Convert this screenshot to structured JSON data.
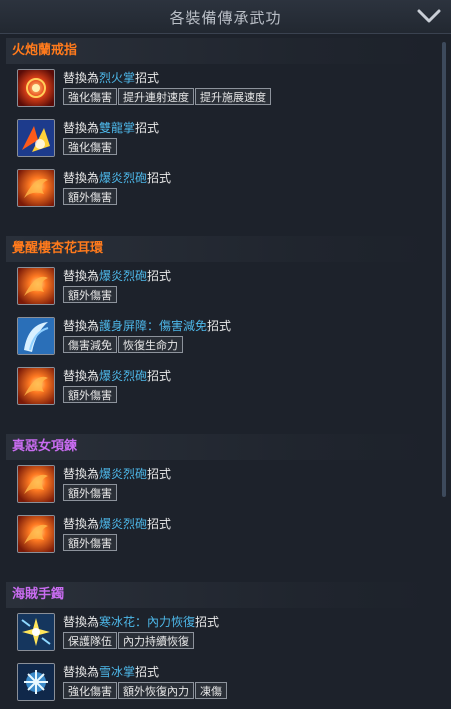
{
  "header": {
    "title": "各裝備傳承武功",
    "collapse_icon": "chevron-down-icon"
  },
  "common": {
    "prefix": "替換為",
    "suffix": "招式"
  },
  "colors": {
    "section_orange": "#ff7a1c",
    "section_purple": "#c86cf0",
    "skill_blue": "#4db7e8"
  },
  "sections": [
    {
      "title": "火炮蘭戒指",
      "color": "#ff7a1c",
      "items": [
        {
          "icon": "fire-palm-icon",
          "skill": "烈火掌",
          "tags": [
            "強化傷害",
            "提升連射速度",
            "提升施展速度"
          ]
        },
        {
          "icon": "twin-dragon-palm-icon",
          "skill": "雙龍掌",
          "tags": [
            "強化傷害"
          ]
        },
        {
          "icon": "flame-cannon-icon",
          "skill": "爆炎烈砲",
          "tags": [
            "額外傷害"
          ]
        }
      ]
    },
    {
      "title": "覺醒樓杏花耳環",
      "color": "#ff7a1c",
      "items": [
        {
          "icon": "flame-cannon-icon",
          "skill": "爆炎烈砲",
          "tags": [
            "額外傷害"
          ]
        },
        {
          "icon": "barrier-icon",
          "skill": "護身屏障：傷害減免",
          "tags": [
            "傷害減免",
            "恢復生命力"
          ]
        },
        {
          "icon": "flame-cannon-icon",
          "skill": "爆炎烈砲",
          "tags": [
            "額外傷害"
          ]
        }
      ]
    },
    {
      "title": "真惡女項鍊",
      "color": "#c86cf0",
      "items": [
        {
          "icon": "flame-cannon-icon",
          "skill": "爆炎烈砲",
          "tags": [
            "額外傷害"
          ]
        },
        {
          "icon": "flame-cannon-icon",
          "skill": "爆炎烈砲",
          "tags": [
            "額外傷害"
          ]
        }
      ]
    },
    {
      "title": "海賊手鐲",
      "color": "#c86cf0",
      "items": [
        {
          "icon": "frost-flower-icon",
          "skill": "寒冰花：內力恢復",
          "tags": [
            "保護隊伍",
            "內力持續恢復"
          ]
        },
        {
          "icon": "snow-palm-icon",
          "skill": "雪冰掌",
          "tags": [
            "強化傷害",
            "額外恢復內力",
            "凍傷"
          ]
        }
      ]
    }
  ]
}
